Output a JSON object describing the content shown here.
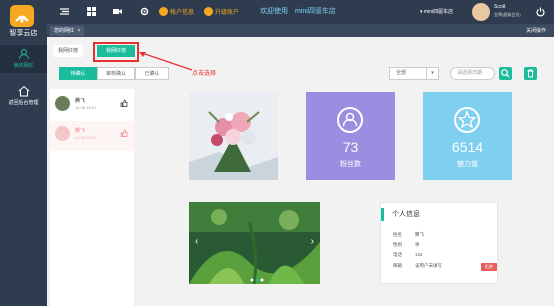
{
  "app": {
    "logo_text": "智享云店"
  },
  "sidebar": {
    "items": [
      {
        "label": "我的网红"
      },
      {
        "label": "返回后台管理"
      }
    ]
  },
  "topbar": {
    "account_manage": "帐户信息",
    "upgrade": "升级账户",
    "welcome": "欢迎使用",
    "store_name": "mini四驱车店",
    "dropdown_label": "mini四驱车店",
    "user_name": "Scott",
    "user_role": "金牌(超级会员)"
  },
  "subbar": {
    "tab": "您的网红",
    "tab_close": "×",
    "right_label": "关闭操作"
  },
  "tabs": {
    "all_label": "我网红榜",
    "mine_label": "我网红榜"
  },
  "filters": {
    "seg1": "待确认",
    "seg2": "审核确认",
    "seg3": "已确认",
    "select_value": "全部",
    "search_placeholder": "请选择日期"
  },
  "list": {
    "items": [
      {
        "name": "腾飞",
        "time": "12-08 10:07"
      },
      {
        "name": "腾飞",
        "time": "12-09 09:00"
      }
    ]
  },
  "stats": {
    "fans": {
      "value": "73",
      "label": "粉丝数"
    },
    "charm": {
      "value": "6514",
      "label": "魅力值"
    }
  },
  "profile": {
    "title": "个人信息",
    "rows": [
      {
        "k": "姓名",
        "v": "腾飞"
      },
      {
        "k": "性别",
        "v": "男"
      },
      {
        "k": "电话",
        "v": "134"
      },
      {
        "k": "邮箱",
        "v": "该用户未填写"
      }
    ],
    "action": "拒绝"
  },
  "annotation": {
    "text": "点击选择"
  },
  "colors": {
    "accent": "#1abc9c",
    "purple": "#9b8ee0",
    "blue": "#7fcff0",
    "sidebar": "#2f3c4f",
    "annot_red": "#e63030"
  }
}
